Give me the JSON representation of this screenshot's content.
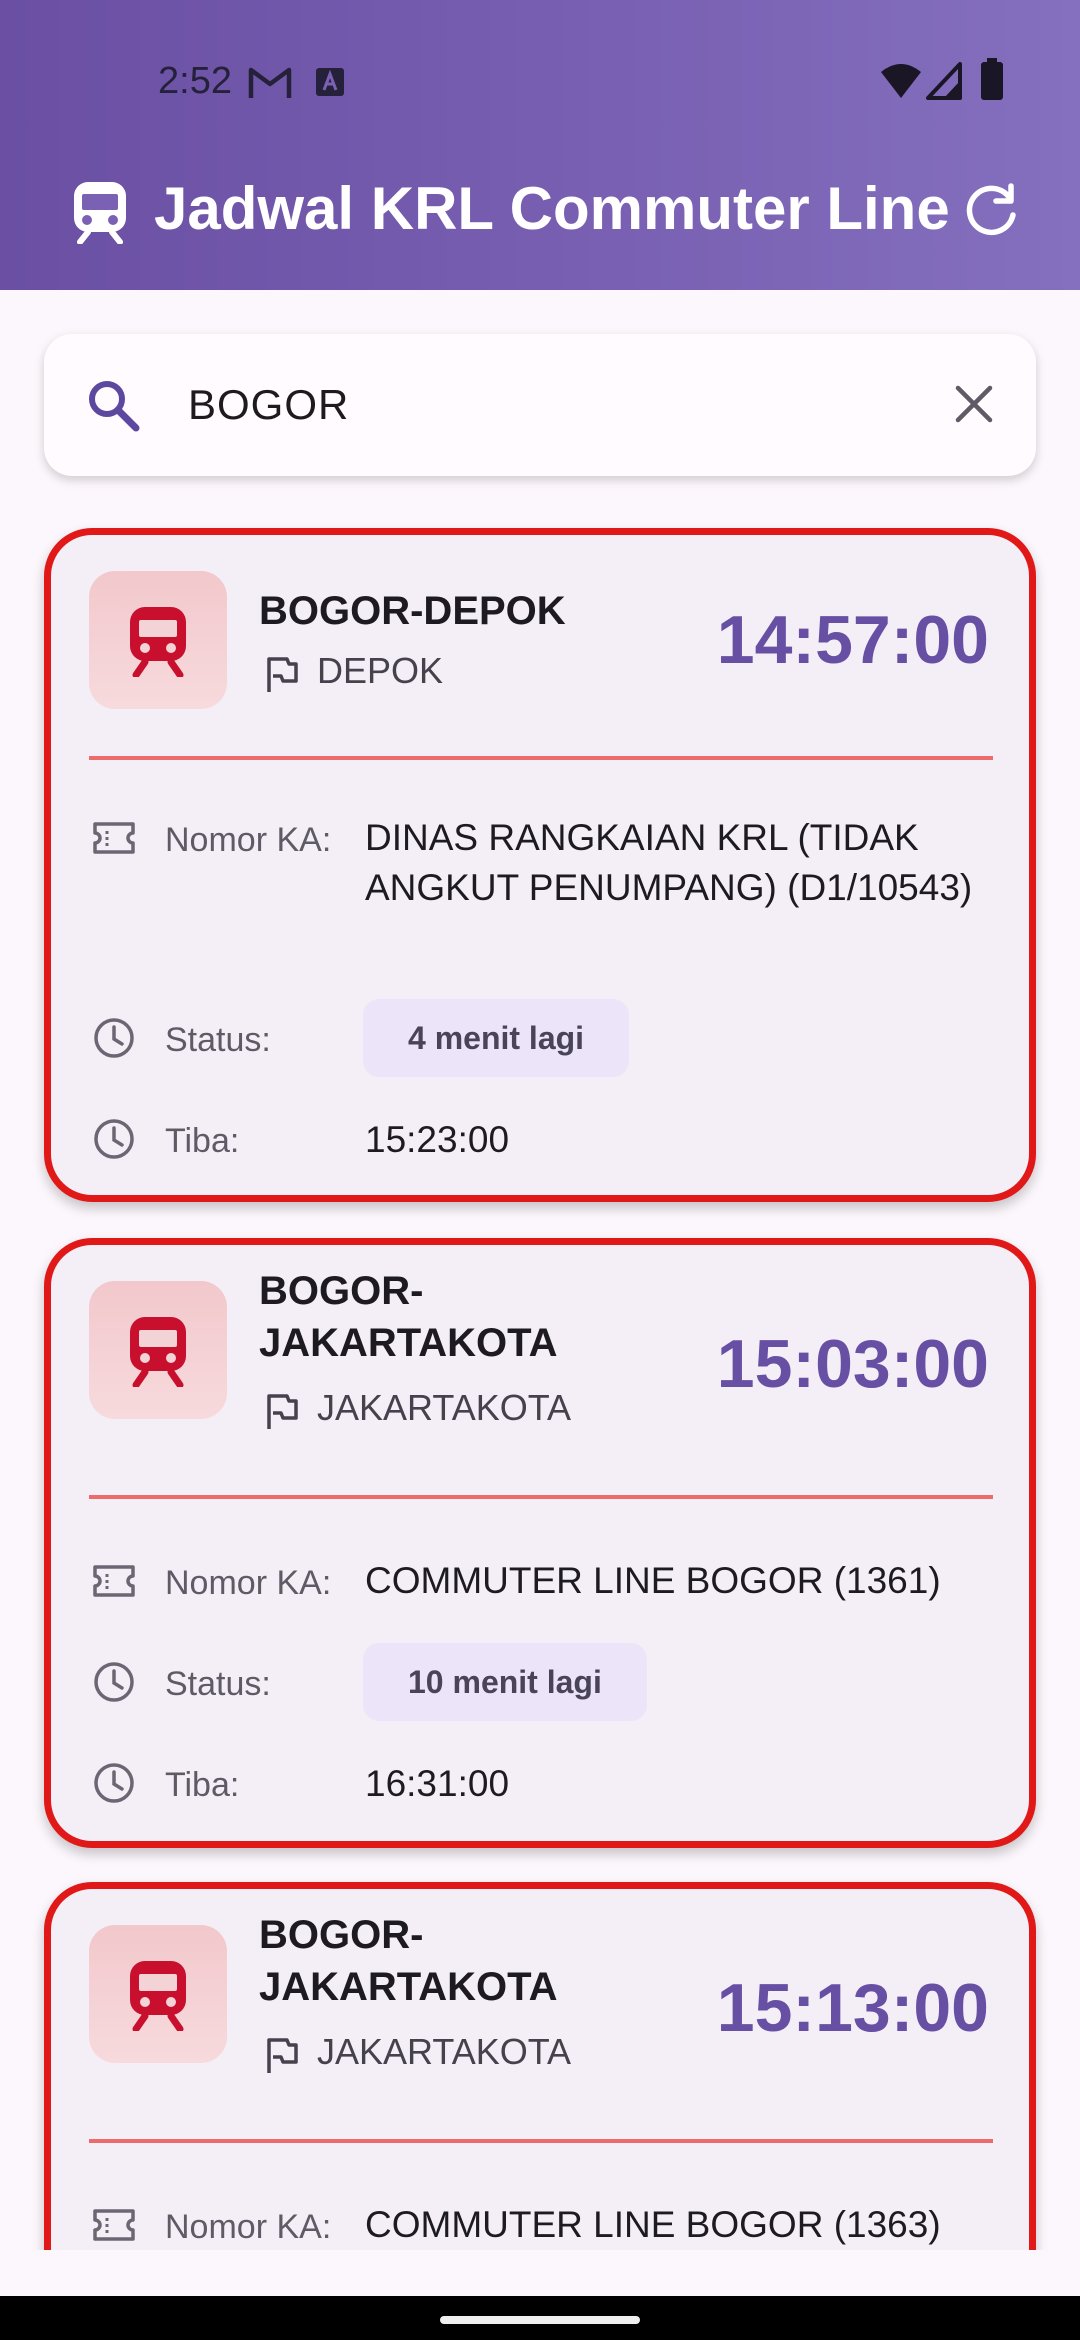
{
  "status_bar": {
    "time": "2:52"
  },
  "app": {
    "title": "Jadwal KRL Commuter Line"
  },
  "search": {
    "value": "BOGOR",
    "placeholder": ""
  },
  "labels": {
    "train_no": "Nomor KA:",
    "status": "Status:",
    "arrival": "Tiba:"
  },
  "schedules": [
    {
      "route": "BOGOR-DEPOK",
      "destination": "DEPOK",
      "departure": "14:57:00",
      "train_no": "DINAS RANGKAIAN KRL (TIDAK ANGKUT PENUMPANG) (D1/10543)",
      "status": "4 menit lagi",
      "arrival": "15:23:00"
    },
    {
      "route": "BOGOR-JAKARTAKOTA",
      "destination": "JAKARTAKOTA",
      "departure": "15:03:00",
      "train_no": "COMMUTER LINE BOGOR (1361)",
      "status": "10 menit lagi",
      "arrival": "16:31:00"
    },
    {
      "route": "BOGOR-JAKARTAKOTA",
      "destination": "JAKARTAKOTA",
      "departure": "15:13:00",
      "train_no": "COMMUTER LINE BOGOR (1363)"
    }
  ],
  "colors": {
    "header": "#7a61b3",
    "accent": "#6750a4",
    "card_border": "#e01818",
    "train_icon": "#c8102e"
  },
  "icons": [
    "gmail-icon",
    "keyboard-a-icon",
    "wifi-icon",
    "signal-icon",
    "battery-icon",
    "train-icon",
    "refresh-icon",
    "search-icon",
    "close-icon",
    "flag-icon",
    "ticket-icon",
    "clock-icon"
  ]
}
